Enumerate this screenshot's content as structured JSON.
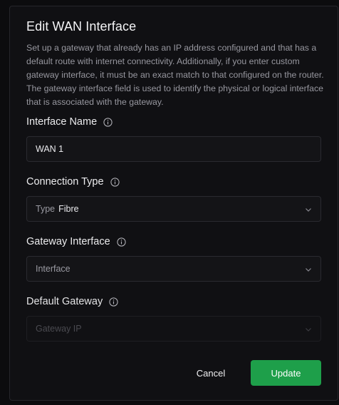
{
  "dialog": {
    "title": "Edit WAN Interface",
    "description": "Set up a gateway that already has an IP address configured and that has a default route with internet connectivity. Additionally, if you enter custom gateway interface, it must be an exact match to that configured on the router. The gateway interface field is used to identify the physical or logical interface that is associated with the gateway."
  },
  "fields": {
    "interface_name": {
      "label": "Interface Name",
      "value": "WAN 1"
    },
    "connection_type": {
      "label": "Connection Type",
      "prefix": "Type",
      "value": "Fibre"
    },
    "gateway_interface": {
      "label": "Gateway Interface",
      "placeholder": "Interface"
    },
    "default_gateway": {
      "label": "Default Gateway",
      "placeholder": "Gateway IP",
      "disabled": true
    }
  },
  "buttons": {
    "cancel": "Cancel",
    "update": "Update"
  },
  "colors": {
    "primary": "#1e9f4a",
    "background": "#101013",
    "border": "#2a2a30",
    "muted_text": "#97979f"
  },
  "icons": {
    "info": "info-circle-icon",
    "dropdown": "chevron-down-icon"
  }
}
